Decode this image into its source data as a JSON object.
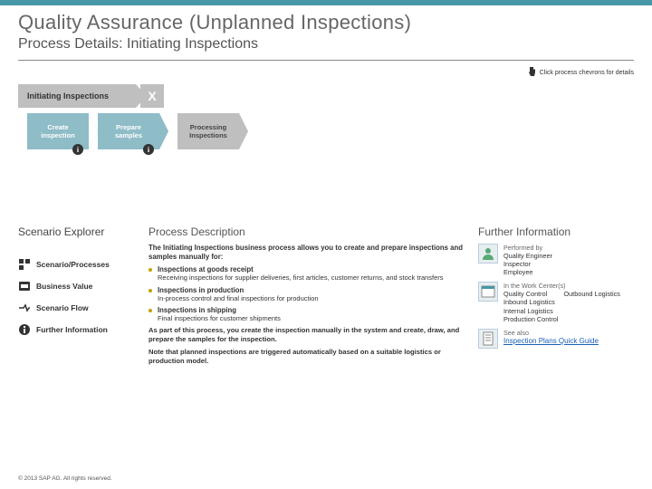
{
  "header": {
    "title": "Quality Assurance (Unplanned Inspections)",
    "subtitle": "Process Details: Initiating Inspections"
  },
  "hint": "Click process chevrons for details",
  "flow": {
    "section_label": "Initiating Inspections",
    "close": "X",
    "steps": {
      "s1": "Create inspection",
      "s2": "Prepare samples",
      "s3": "Processing Inspections"
    },
    "info_badge": "i"
  },
  "explorer": {
    "title": "Scenario Explorer",
    "items": {
      "scenarios": "Scenario/Processes",
      "value": "Business Value",
      "flow": "Scenario Flow",
      "further": "Further Information"
    }
  },
  "process": {
    "title": "Process Description",
    "intro": "The Initiating Inspections business process allows you to create and prepare inspections and samples manually for:",
    "b1": {
      "title": "Inspections at goods receipt",
      "text": "Receiving inspections for supplier deliveries, first articles, customer returns, and stock transfers"
    },
    "b2": {
      "title": "Inspections in production",
      "text": "In-process control and final inspections for production"
    },
    "b3": {
      "title": "Inspections in shipping",
      "text": "Final inspections for customer shipments"
    },
    "p1": "As part of this process, you create the inspection manually in the system and create, draw, and prepare the samples for the inspection.",
    "p2": "Note that planned inspections are triggered automatically based on a suitable logistics or production model."
  },
  "further": {
    "title": "Further Information",
    "performed_label": "Performed by",
    "performed_vals": "Quality Engineer\nInspector\nEmployee",
    "wc_label": "In the Work Center(s)",
    "wc_col1": "Quality Control\nInbound Logistics\nInternal Logistics\nProduction Control",
    "wc_col2": "Outbound Logistics",
    "see_label": "See also",
    "see_link": "Inspection Plans Quick Guide"
  },
  "copyright": "© 2013 SAP AG. All rights reserved."
}
